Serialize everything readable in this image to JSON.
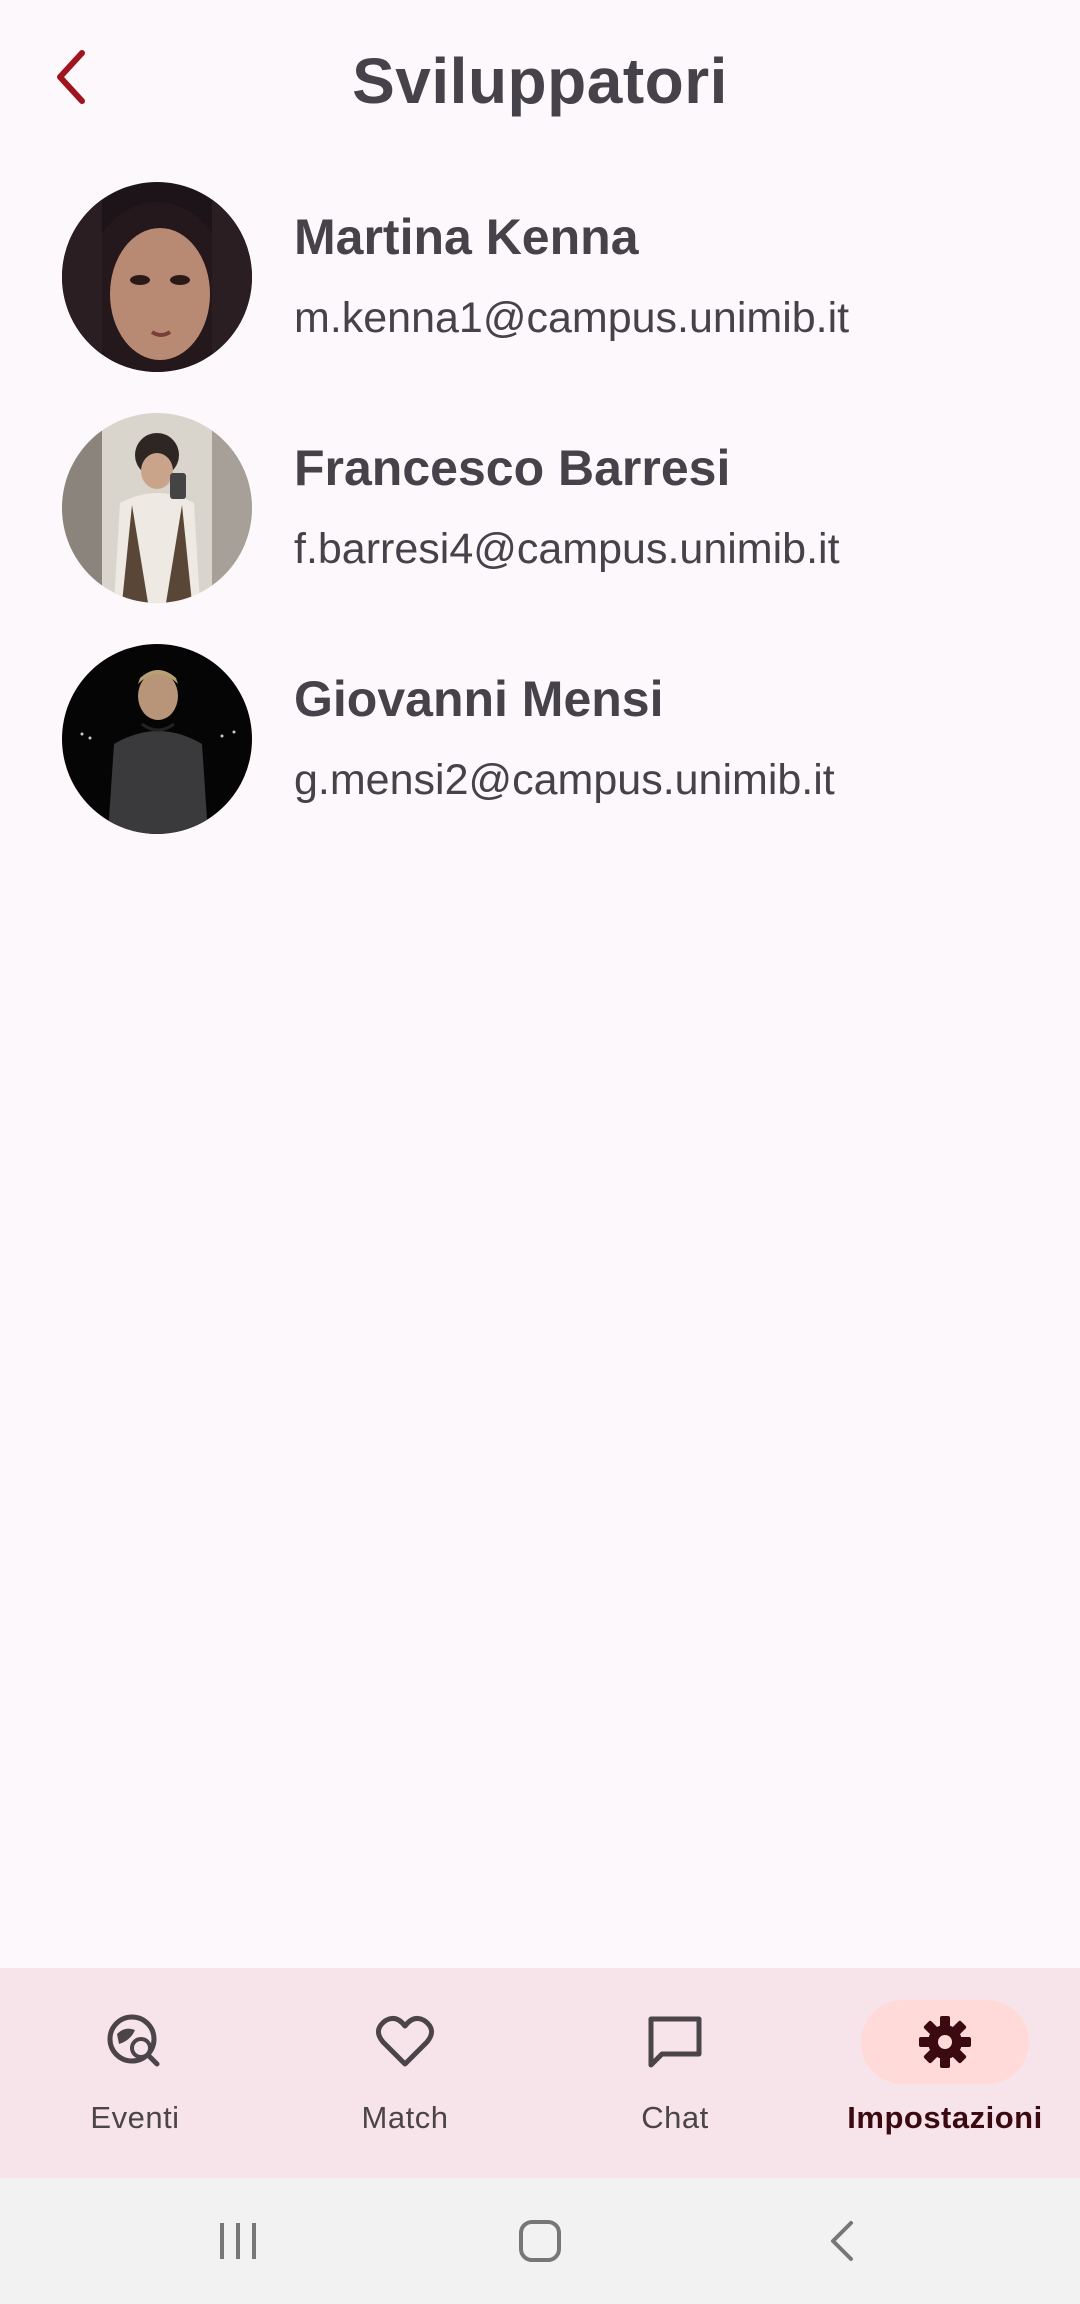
{
  "header": {
    "title": "Sviluppatori",
    "back_icon": "chevron-left-icon",
    "accent_color": "#a0141e"
  },
  "developers": [
    {
      "name": "Martina Kenna",
      "email": "m.kenna1@campus.unimib.it"
    },
    {
      "name": "Francesco Barresi",
      "email": "f.barresi4@campus.unimib.it"
    },
    {
      "name": "Giovanni Mensi",
      "email": "g.mensi2@campus.unimib.it"
    }
  ],
  "bottom_nav": {
    "items": [
      {
        "label": "Eventi",
        "icon": "explore-search-icon",
        "active": false
      },
      {
        "label": "Match",
        "icon": "heart-icon",
        "active": false
      },
      {
        "label": "Chat",
        "icon": "chat-bubble-icon",
        "active": false
      },
      {
        "label": "Impostazioni",
        "icon": "gear-icon",
        "active": true
      }
    ],
    "background": "#f6e4ea",
    "active_pill": "#ffdad8"
  },
  "system_nav": {
    "items": [
      "recent-apps-icon",
      "home-icon",
      "back-icon"
    ]
  }
}
